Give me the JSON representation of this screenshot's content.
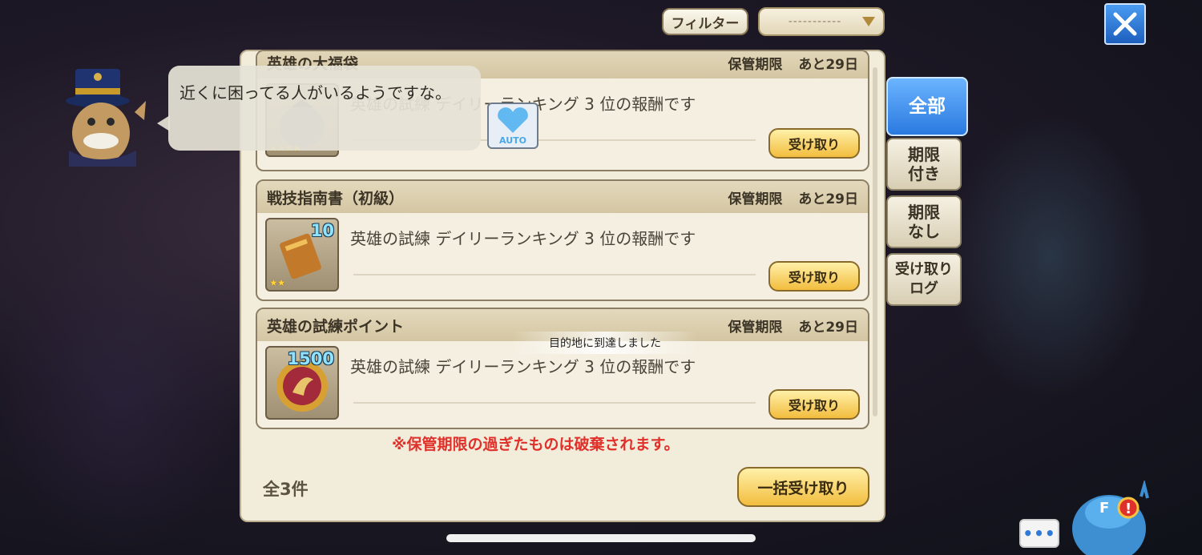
{
  "top": {
    "filter_label": "フィルター",
    "dropdown_value": "-----------",
    "close_icon": "close-x-icon"
  },
  "speech": {
    "text": "近くに困ってる人がいるようですな。"
  },
  "cards": [
    {
      "title": "英雄の大福袋",
      "expiry_label": "保管期限",
      "expiry_value": "あと29日",
      "description": "英雄の試練 デイリーランキング 3 位の報酬です",
      "count": "",
      "stars": "★★★★",
      "receive_label": "受け取り"
    },
    {
      "title": "戦技指南書（初級）",
      "expiry_label": "保管期限",
      "expiry_value": "あと29日",
      "description": "英雄の試練 デイリーランキング 3 位の報酬です",
      "count": "10",
      "stars": "★★",
      "receive_label": "受け取り"
    },
    {
      "title": "英雄の試練ポイント",
      "expiry_label": "保管期限",
      "expiry_value": "あと29日",
      "description": "英雄の試練 デイリーランキング 3 位の報酬です",
      "count": "1500",
      "stars": "",
      "receive_label": "受け取り"
    }
  ],
  "auto_label": "AUTO",
  "toast": "目的地に到達しました",
  "notice": "※保管期限の過ぎたものは破棄されます。",
  "total": "全3件",
  "bulk_receive_label": "一括受け取り",
  "tabs": {
    "all": "全部",
    "limited_1": "期限",
    "limited_2": "付き",
    "unlimited_1": "期限",
    "unlimited_2": "なし",
    "log_1": "受け取り",
    "log_2": "ログ"
  },
  "chat_icon": "•••",
  "colors": {
    "accent_blue": "#2a79e0",
    "notice_red": "#e0302a",
    "button_gold": "#f2bd3e"
  }
}
